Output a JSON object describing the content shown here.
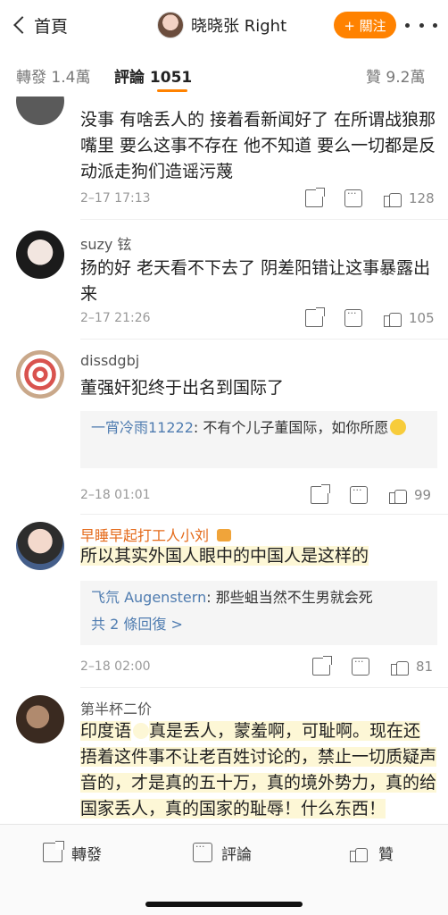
{
  "nav": {
    "back_label": "首頁",
    "title": "晓晓张 Right",
    "follow_label": "+ 關注"
  },
  "tabs": {
    "repost": "轉發 1.4萬",
    "comments": "評論 1051",
    "likes": "贊 9.2萬"
  },
  "comments": [
    {
      "user": "",
      "body": "没事 有啥丢人的 接着看新闻好了 在所谓战狼那嘴里 要么这事不存在 他不知道 要么一切都是反动派走狗们造谣污蔑",
      "date": "2–17 17:13",
      "likes": "128"
    },
    {
      "user": "suzy 铉",
      "body": "扬的好  老天看不下去了  阴差阳错让这事暴露出来",
      "date": "2–17 21:26",
      "likes": "105"
    },
    {
      "user": "dissdgbj",
      "body": "董强奸犯终于出名到国际了",
      "reply_name": "一宵冷雨11222",
      "reply_text": ": 不有个儿子董国际，如你所愿",
      "date": "2–18 01:01",
      "likes": "99"
    },
    {
      "user": "早睡早起打工人小刘",
      "body": "所以其实外国人眼中的中国人是这样的",
      "reply_name": "飞氘 Augenstern",
      "reply_text": ": 那些蛆当然不生男就会死",
      "more_replies": "共 2 條回復 >",
      "date": "2–18 02:00",
      "likes": "81"
    },
    {
      "user": "第半杯二价",
      "body_prefix": "印度语",
      "body": "真是丢人，蒙羞啊，可耻啊。现在还捂着这件事不让老百姓讨论的，禁止一切质疑声音的，才是真的五十万，真的境外势力，真的给国家丢人，真的国家的耻辱！什么东西！"
    }
  ],
  "bottom": {
    "repost": "轉發",
    "comment": "評論",
    "like": "贊"
  },
  "colors": {
    "accent": "#ff8200",
    "link": "#4f7cb0",
    "highlight": "#fdf7d6",
    "vip_name": "#e46a1a"
  }
}
